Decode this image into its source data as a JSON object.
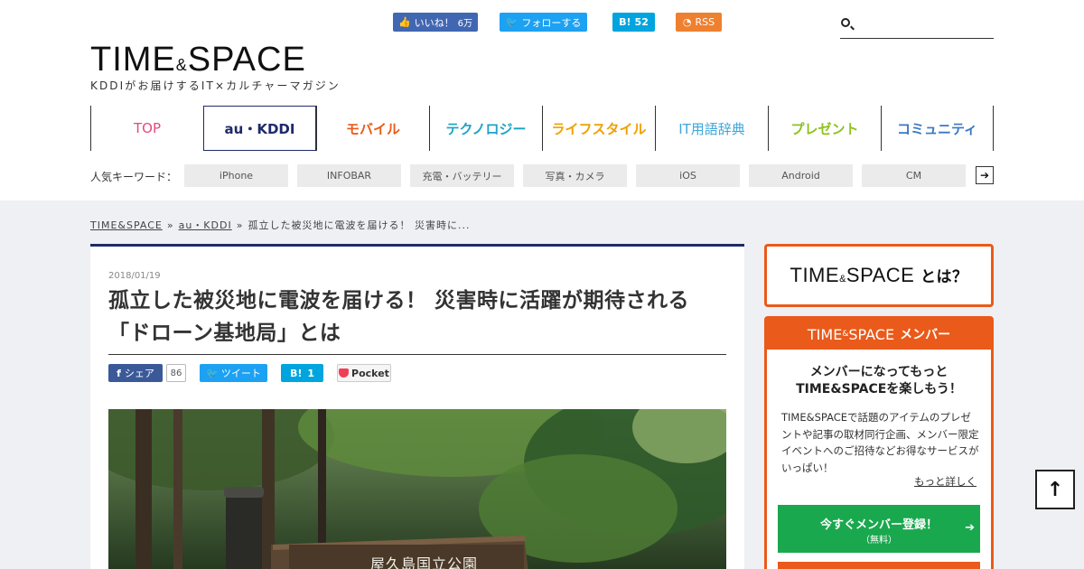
{
  "header": {
    "social": {
      "facebook_label": "いいね！",
      "facebook_count": "6万",
      "twitter_label": "フォローする",
      "hatena_label": "B!",
      "hatena_count": "52",
      "rss_label": "RSS"
    },
    "search": {
      "placeholder": "",
      "icon": "search-icon"
    },
    "logo": {
      "main1": "TIME",
      "amp": "&",
      "main2": "SPACE"
    },
    "tagline": "KDDIがお届けするIT×カルチャーマガジン"
  },
  "nav": {
    "items": [
      {
        "label": "TOP",
        "color": "#e5497f"
      },
      {
        "label": "au・KDDI",
        "color": "#1f2a6b"
      },
      {
        "label": "モバイル",
        "color": "#ea5a1a"
      },
      {
        "label": "テクノロジー",
        "color": "#1ba3c6"
      },
      {
        "label": "ライフスタイル",
        "color": "#f0a000"
      },
      {
        "label": "IT用語辞典",
        "color": "#3fa6d9"
      },
      {
        "label": "プレゼント",
        "color": "#8cc21f"
      },
      {
        "label": "コミュニティ",
        "color": "#3b78c4"
      }
    ]
  },
  "keywords": {
    "label": "人気キーワード：",
    "chips": [
      "iPhone",
      "INFOBAR",
      "充電・バッテリー",
      "写真・カメラ",
      "iOS",
      "Android",
      "CM"
    ],
    "next": "➔"
  },
  "breadcrumb": {
    "home": "TIME&SPACE",
    "category": "au・KDDI",
    "current": "孤立した被災地に電波を届ける！ 災害時に...",
    "sep": "»"
  },
  "article": {
    "date": "2018/01/19",
    "title_line1": "孤立した被災地に電波を届ける！ 災害時に活躍が期待される",
    "title_line2": "「ドローン基地局」とは",
    "share": {
      "facebook_label": "シェア",
      "facebook_count": "86",
      "twitter_label": "ツイート",
      "hatena_label": "B!",
      "hatena_count": "1",
      "pocket_label": "Pocket"
    },
    "photo_sign_text": "屋久島国立公園"
  },
  "sidebar": {
    "about": {
      "main1": "TIME",
      "amp": "&",
      "main2": "SPACE",
      "suffix": "とは？"
    },
    "member": {
      "head_main1": "TIME",
      "head_amp": "&",
      "head_main2": "SPACE",
      "head_suffix": "メンバー",
      "lead_line1": "メンバーになってもっと",
      "lead_line2": "TIME&SPACEを楽しもう！",
      "desc": "TIME&SPACEで話題のアイテムのプレゼントや記事の取材同行企画、メンバー限定イベントへのご招待などお得なサービスがいっぱい！",
      "more": "もっと詳しく",
      "cta_label": "今すぐメンバー登録！",
      "cta_sub": "（無料）",
      "cta_arrow": "➔"
    }
  },
  "totop": "↑",
  "colors": {
    "brand_orange": "#ea5a1a",
    "navy": "#1f2a6b",
    "cta_green": "#1aa84e"
  }
}
